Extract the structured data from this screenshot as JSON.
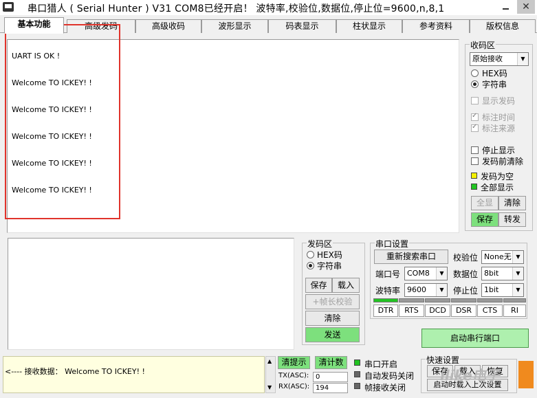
{
  "window": {
    "title": "串口猎人 ( Serial Hunter ) V31     COM8已经开启！ 波特率,校验位,数据位,停止位=9600,n,8,1",
    "close_glyph": "✕"
  },
  "tabs": [
    {
      "label": "基本功能",
      "active": true
    },
    {
      "label": "高级发码"
    },
    {
      "label": "高级收码"
    },
    {
      "label": "波形显示"
    },
    {
      "label": "码表显示"
    },
    {
      "label": "柱状显示"
    },
    {
      "label": "参考资料"
    },
    {
      "label": "版权信息"
    }
  ],
  "receive": {
    "lines": [
      "UART IS OK !",
      "Welcome TO ICKEY! !",
      "Welcome TO ICKEY! !",
      "Welcome TO ICKEY! !",
      "Welcome TO ICKEY! !",
      "Welcome TO ICKEY! !"
    ]
  },
  "recv_panel": {
    "legend": "收码区",
    "mode_select": "原始接收",
    "hex_label": "HEX码",
    "string_label": "字符串",
    "show_sent": "显示发码",
    "mark_time": "标注时间",
    "mark_source": "标注来源",
    "stop_display": "停止显示",
    "clear_before_send": "发码前清除",
    "send_empty": "发码为空",
    "show_all": "全部显示",
    "btn_all": "全显",
    "btn_clear": "清除",
    "btn_save": "保存",
    "btn_forward": "转发"
  },
  "send_panel": {
    "legend": "发码区",
    "hex_label": "HEX码",
    "string_label": "字符串",
    "btn_save": "保存",
    "btn_load": "载入",
    "btn_frame_check": "+帧长校验",
    "btn_clear": "清除",
    "btn_send": "发送"
  },
  "port_settings": {
    "legend": "串口设置",
    "btn_rescan": "重新搜索串口",
    "parity_label": "校验位",
    "parity_value": "None无",
    "port_label": "端口号",
    "port_value": "COM8",
    "databits_label": "数据位",
    "databits_value": "8bit",
    "baud_label": "波特率",
    "baud_value": "9600",
    "stopbits_label": "停止位",
    "stopbits_value": "1bit",
    "signals": [
      "DTR",
      "RTS",
      "DCD",
      "DSR",
      "CTS",
      "RI"
    ],
    "btn_open": "启动串行端口"
  },
  "status": {
    "message": "<---- 接收数据：  Welcome TO ICKEY! !",
    "btn_clear_hint": "清提示",
    "btn_clear_count": "清计数",
    "tx_label": "TX(ASC):",
    "tx_value": "0",
    "rx_label": "RX(ASC):",
    "rx_value": "194",
    "port_open": "串口开启",
    "auto_send_off": "自动发码关闭",
    "frame_recv_off": "帧接收关闭",
    "quick_legend": "快速设置",
    "btn_quick_save": "保存",
    "btn_quick_load": "载入",
    "btn_quick_restore": "恢复",
    "btn_startup_load": "启动时载入上次设置",
    "watermark": "ilike电子"
  },
  "colors": {
    "green_button": "#7de07d",
    "red_highlight": "#e0332b",
    "led_yellow": "#f4f000",
    "led_green": "#22c422"
  }
}
